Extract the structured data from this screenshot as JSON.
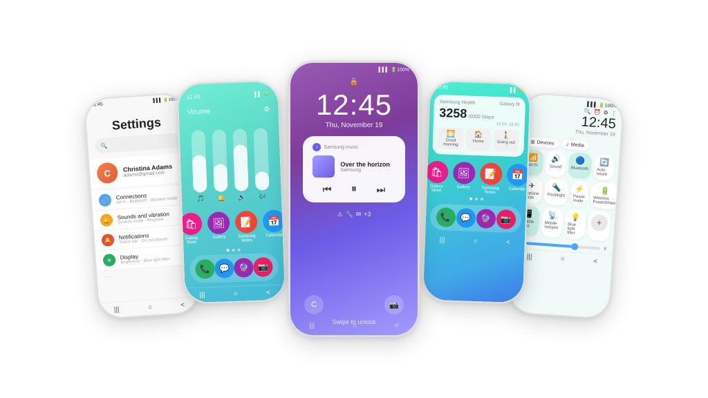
{
  "scene": {
    "bg": "#ffffff"
  },
  "phone1": {
    "screen": "settings",
    "status": {
      "time": "12:45",
      "signal": "▌▌▌",
      "battery": "100%"
    },
    "title": "Settings",
    "search_placeholder": "🔍",
    "user": {
      "name": "Christina Adams",
      "email": "adams@gmail.com",
      "avatar_text": "C"
    },
    "items": [
      {
        "icon": "🔗",
        "icon_color": "#4ea6f5",
        "label": "Connections",
        "sub": "Wi-Fi · Bluetooth · Airplane mode"
      },
      {
        "icon": "🔔",
        "icon_color": "#f5a623",
        "label": "Sounds and vibration",
        "sub": "Sounds mode · Ringtone"
      },
      {
        "icon": "🔔",
        "icon_color": "#e74c3c",
        "label": "Notifications",
        "sub": "Status bar · Do not disturb"
      },
      {
        "icon": "☀",
        "icon_color": "#27ae60",
        "label": "Display",
        "sub": "Brightness · Blue light filter · Navigation bar"
      }
    ],
    "nav": [
      "|||",
      "○",
      "<"
    ]
  },
  "phone2": {
    "screen": "volume",
    "status": {
      "time": "12:45",
      "signal": "▌▌",
      "battery": "4"
    },
    "title": "Volume",
    "sliders": [
      {
        "fill_pct": 60
      },
      {
        "fill_pct": 45
      },
      {
        "fill_pct": 75
      },
      {
        "fill_pct": 30
      }
    ],
    "slider_icons": [
      "🎵",
      "🔔",
      "🔊",
      "🎶"
    ],
    "apps": [
      {
        "label": "Galaxy Store",
        "bg": "#e91e8c"
      },
      {
        "label": "Gallery",
        "bg": "#9c27b0"
      },
      {
        "label": "Samsung Notes",
        "bg": "#f44336"
      },
      {
        "label": "Calendar",
        "bg": "#2196f3"
      }
    ],
    "dock": [
      {
        "label": "Phone",
        "bg": "#27ae60"
      },
      {
        "label": "Messages",
        "bg": "#2196f3"
      },
      {
        "label": "Bixby",
        "bg": "#9c27b0"
      },
      {
        "label": "Camera",
        "bg": "#e91e63"
      }
    ],
    "nav": [
      "|||",
      "○",
      "<"
    ]
  },
  "phone3": {
    "screen": "lockscreen",
    "status": {
      "signal": "▌▌▌",
      "battery": "100%"
    },
    "lock_icon": "🔒",
    "time": "12:45",
    "date": "Thu, November 19",
    "music": {
      "app": "Samsung music",
      "title": "Over the horizon",
      "artist": "Samsung",
      "controls": [
        "⏮",
        "⏸",
        "⏭"
      ]
    },
    "notif_icons": [
      "⚠",
      "🔧",
      "✉",
      "+3"
    ],
    "swipe_text": "Swipe to unlock",
    "bottom_btns": [
      "C",
      "📷"
    ],
    "nav": [
      "|||",
      "○",
      "<"
    ]
  },
  "phone4": {
    "screen": "home",
    "status": {
      "time": "12:45",
      "signal": "▌▌",
      "battery": "4"
    },
    "health_card": {
      "title": "Samsung Health",
      "subtitle": "Galaxy fit",
      "steps": "3258",
      "steps_total": "/6000 Steps",
      "date": "11/19, 18:40",
      "btns": [
        {
          "icon": "🌅",
          "label": "Good morning"
        },
        {
          "icon": "🏠",
          "label": "Home"
        },
        {
          "icon": "🚶",
          "label": "Going out"
        }
      ]
    },
    "apps": [
      {
        "label": "Galaxy Store",
        "bg": "#e91e8c"
      },
      {
        "label": "Gallery",
        "bg": "#9c27b0"
      },
      {
        "label": "Samsung Notes",
        "bg": "#f44336"
      },
      {
        "label": "Calendar",
        "bg": "#2196f3"
      }
    ],
    "dock": [
      {
        "label": "Phone",
        "bg": "#27ae60"
      },
      {
        "label": "Messages",
        "bg": "#2196f3"
      },
      {
        "label": "Bixby",
        "bg": "#9c27b0"
      },
      {
        "label": "Camera",
        "bg": "#e91e63"
      }
    ],
    "nav": [
      "|||",
      "○",
      "<"
    ]
  },
  "phone5": {
    "screen": "quicksettings",
    "status": {
      "signal": "▌▌▌",
      "battery": "100%"
    },
    "top_icons": [
      "🔍",
      "⏰",
      "⚙",
      "⋮"
    ],
    "time": "12:45",
    "date": "Thu, November 19",
    "devices_label": "Devices",
    "media_label": "Media",
    "tiles_row1": [
      {
        "icon": "📶",
        "label": "Wi-Fi",
        "active": true
      },
      {
        "icon": "🔊",
        "label": "Sound",
        "active": false
      },
      {
        "icon": "🔵",
        "label": "Bluetooth",
        "active": true
      },
      {
        "icon": "🔄",
        "label": "Auto rotate",
        "active": false
      }
    ],
    "tiles_row2": [
      {
        "icon": "✈",
        "label": "Airplane mode",
        "active": false
      },
      {
        "icon": "🔦",
        "label": "Flashlight",
        "active": false
      },
      {
        "icon": "⚡",
        "label": "Power mode",
        "active": false
      },
      {
        "icon": "🔋",
        "label": "Wireless PowerShare",
        "active": false
      }
    ],
    "tiles_row3": [
      {
        "icon": "📱",
        "label": "Mobile data",
        "active": true
      },
      {
        "icon": "📡",
        "label": "Mobile hotspot",
        "active": false
      },
      {
        "icon": "💡",
        "label": "Blue light filter",
        "active": false
      },
      {
        "icon": "+",
        "label": "",
        "is_add": true
      }
    ],
    "brightness_pct": 65,
    "nav": [
      "|||",
      "○",
      "<"
    ]
  }
}
